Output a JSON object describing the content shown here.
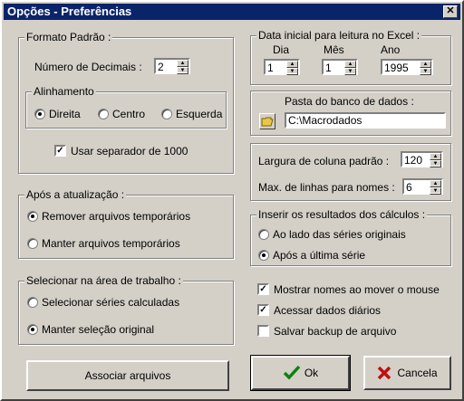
{
  "window": {
    "title": "Opções - Preferências",
    "close_glyph": "✕"
  },
  "formato": {
    "legend": "Formato Padrão :",
    "decimais_label": "Número de Decimais :",
    "decimais_value": "2",
    "alinhamento": {
      "legend": "Alinhamento",
      "options": [
        "Direita",
        "Centro",
        "Esquerda"
      ],
      "selected": "Direita"
    },
    "separador_label": "Usar separador de 1000",
    "separador_checked": true
  },
  "apos_atualizacao": {
    "legend": "Após a atualização :",
    "options": [
      "Remover arquivos temporários",
      "Manter arquivos temporários"
    ],
    "selected": "Remover arquivos temporários"
  },
  "selecionar": {
    "legend": "Selecionar na área de trabalho :",
    "options": [
      "Selecionar séries calculadas",
      "Manter seleção original"
    ],
    "selected": "Manter seleção original"
  },
  "associar_button": "Associar arquivos",
  "data_inicial": {
    "legend": "Data inicial para leitura no Excel :",
    "dia_label": "Dia",
    "dia_value": "1",
    "mes_label": "Mês",
    "mes_value": "1",
    "ano_label": "Ano",
    "ano_value": "1995"
  },
  "pasta": {
    "label": "Pasta do banco de dados :",
    "value": "C:\\Macrodados",
    "icon": "folder-icon"
  },
  "largura": {
    "label": "Largura de coluna padrão :",
    "value": "120"
  },
  "max_linhas": {
    "label": "Max. de linhas para nomes :",
    "value": "6"
  },
  "inserir": {
    "legend": "Inserir os resultados dos cálculos :",
    "options": [
      "Ao lado das séries originais",
      "Após a última série"
    ],
    "selected": "Após a última série"
  },
  "checks": [
    {
      "label": "Mostrar nomes ao mover o mouse",
      "checked": true
    },
    {
      "label": "Acessar dados diários",
      "checked": true
    },
    {
      "label": "Salvar backup de arquivo",
      "checked": false
    }
  ],
  "ok_button": "Ok",
  "cancel_button": "Cancela",
  "colors": {
    "title_bg": "#0a246a",
    "dialog_bg": "#d4d0c8",
    "ok_check": "#108010",
    "cancel_x": "#c01010"
  }
}
